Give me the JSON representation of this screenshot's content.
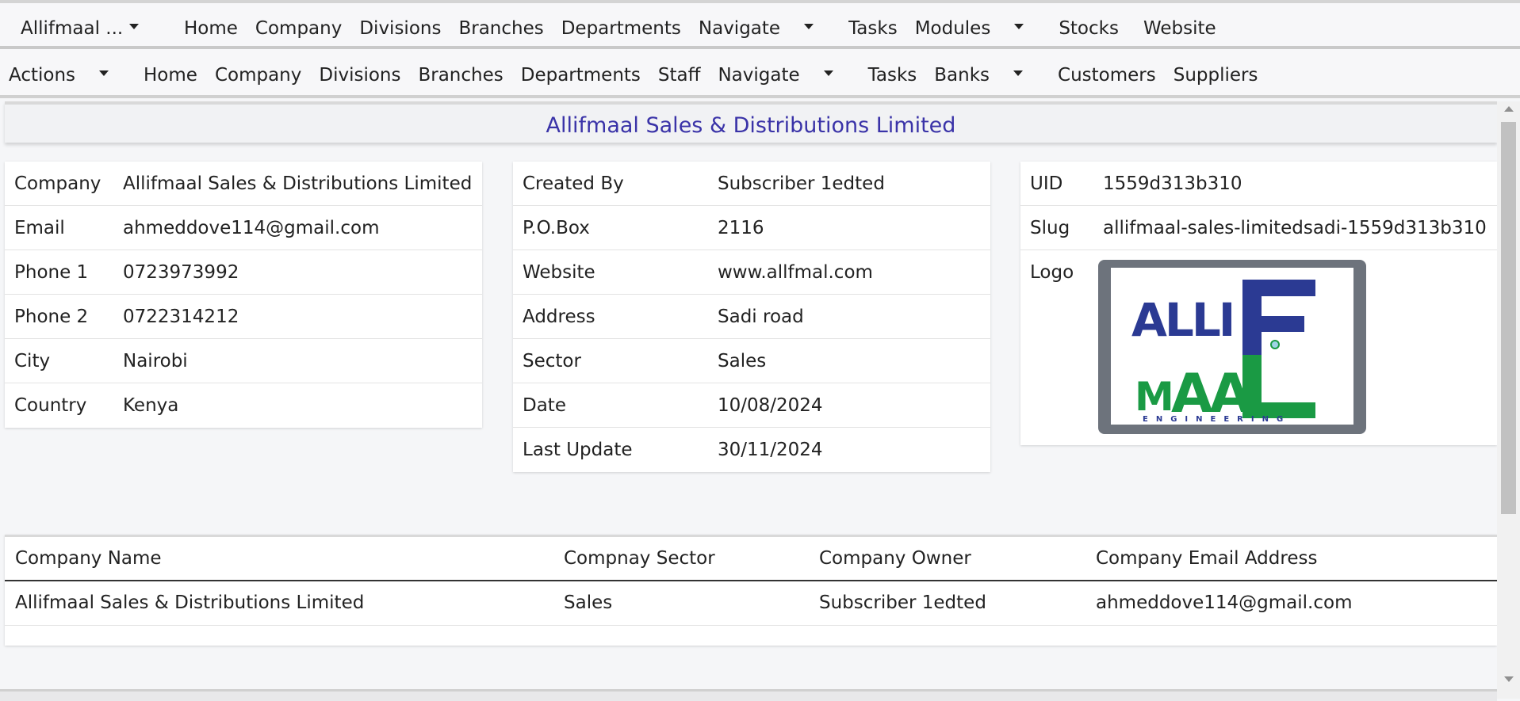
{
  "topnav": {
    "brand": "Allifmaal ...",
    "items": [
      "Home",
      "Company",
      "Divisions",
      "Branches",
      "Departments",
      "Navigate",
      "Tasks",
      "Modules",
      "Stocks",
      "Website"
    ]
  },
  "subnav": {
    "items": [
      "Actions",
      "Home",
      "Company",
      "Divisions",
      "Branches",
      "Departments",
      "Staff",
      "Navigate",
      "Tasks",
      "Banks",
      "Customers",
      "Suppliers"
    ]
  },
  "page": {
    "title": "Allifmaal Sales & Distributions Limited"
  },
  "card1": [
    {
      "label": "Company",
      "value": "Allifmaal Sales & Distributions Limited"
    },
    {
      "label": "Email",
      "value": "ahmeddove114@gmail.com"
    },
    {
      "label": "Phone 1",
      "value": "0723973992"
    },
    {
      "label": "Phone 2",
      "value": "0722314212"
    },
    {
      "label": "City",
      "value": "Nairobi"
    },
    {
      "label": "Country",
      "value": "Kenya"
    }
  ],
  "card2": [
    {
      "label": "Created By",
      "value": "Subscriber 1edted"
    },
    {
      "label": "P.O.Box",
      "value": "2116"
    },
    {
      "label": "Website",
      "value": "www.allfmal.com"
    },
    {
      "label": "Address",
      "value": "Sadi road"
    },
    {
      "label": "Sector",
      "value": "Sales"
    },
    {
      "label": "Date",
      "value": "10/08/2024"
    },
    {
      "label": "Last Update",
      "value": "30/11/2024"
    }
  ],
  "card3": [
    {
      "label": "UID",
      "value": "1559d313b310"
    },
    {
      "label": "Slug",
      "value": "allifmaal-sales-limitedsadi-1559d313b310"
    },
    {
      "label": "Logo"
    }
  ],
  "logo": {
    "text_top": "ALLIF",
    "text_bottom": "MAAL",
    "tagline": "ENGINEERING",
    "blue": "#2b3a93",
    "green": "#1a9a44"
  },
  "table": {
    "headers": [
      "Company Name",
      "Compnay Sector",
      "Company Owner",
      "Company Email Address"
    ],
    "rows": [
      [
        "Allifmaal Sales & Distributions Limited",
        "Sales",
        "Subscriber 1edted",
        "ahmeddove114@gmail.com"
      ]
    ]
  }
}
